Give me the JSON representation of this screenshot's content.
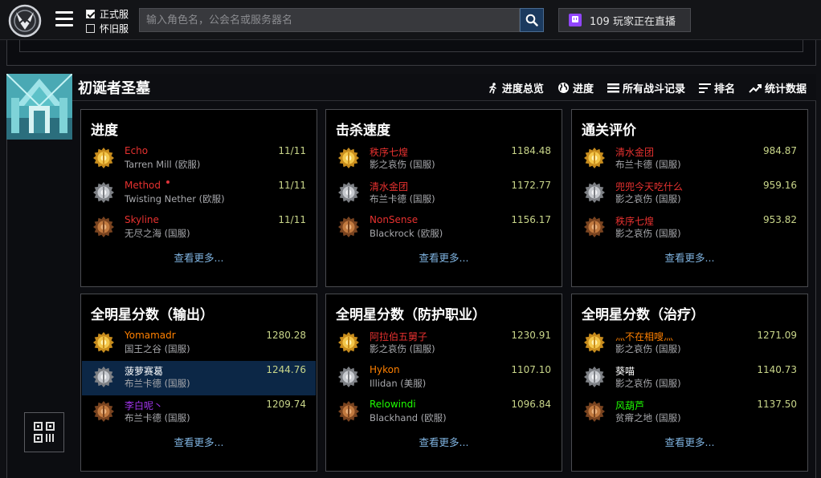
{
  "topbar": {
    "servers": [
      {
        "label": "正式服",
        "checked": true
      },
      {
        "label": "怀旧服",
        "checked": false
      }
    ],
    "search_placeholder": "输入角色名，公会名或服务器名",
    "twitch_text": "109 玩家正在直播"
  },
  "zone": {
    "title": "初诞者圣墓",
    "nav": [
      {
        "label": "进度总览",
        "icon": "runner-icon"
      },
      {
        "label": "进度",
        "icon": "globe-icon"
      },
      {
        "label": "所有战斗记录",
        "icon": "list-icon"
      },
      {
        "label": "排名",
        "icon": "ranking-icon"
      },
      {
        "label": "统计数据",
        "icon": "trend-icon"
      }
    ]
  },
  "colors": {
    "red": "#e6312f",
    "orange": "#ff8000",
    "green": "#1eff00",
    "purple": "#a335ee",
    "white": "#ffffff",
    "value": "#c9d68a",
    "link": "#7fb3e0"
  },
  "panels": [
    {
      "title": "进度",
      "more": "查看更多...",
      "entries": [
        {
          "medal": "gold",
          "name": "Echo",
          "sub": "Tarren Mill (欧服)",
          "value": "11/11",
          "color": "red"
        },
        {
          "medal": "silver",
          "name": "Method",
          "sub": "Twisting Nether (欧服)",
          "value": "11/11",
          "color": "red",
          "dot": true
        },
        {
          "medal": "bronze",
          "name": "Skyline",
          "sub": "无尽之海 (国服)",
          "value": "11/11",
          "color": "red"
        }
      ]
    },
    {
      "title": "击杀速度",
      "more": "查看更多...",
      "entries": [
        {
          "medal": "gold",
          "name": "秩序七煌",
          "sub": "影之哀伤 (国服)",
          "value": "1184.48",
          "color": "red"
        },
        {
          "medal": "silver",
          "name": "清水金团",
          "sub": "布兰卡德 (国服)",
          "value": "1172.77",
          "color": "red"
        },
        {
          "medal": "bronze",
          "name": "NonSense",
          "sub": "Blackrock (欧服)",
          "value": "1156.17",
          "color": "red"
        }
      ]
    },
    {
      "title": "通关评价",
      "more": "查看更多...",
      "entries": [
        {
          "medal": "gold",
          "name": "清水金团",
          "sub": "布兰卡德 (国服)",
          "value": "984.87",
          "color": "red"
        },
        {
          "medal": "silver",
          "name": "兜兜今天吃什么",
          "sub": "影之哀伤 (国服)",
          "value": "959.16",
          "color": "red"
        },
        {
          "medal": "bronze",
          "name": "秩序七煌",
          "sub": "影之哀伤 (国服)",
          "value": "953.82",
          "color": "red"
        }
      ]
    },
    {
      "title": "全明星分数（输出）",
      "more": "查看更多...",
      "entries": [
        {
          "medal": "gold",
          "name": "Yomamadr",
          "sub": "国王之谷 (国服)",
          "value": "1280.28",
          "color": "orange"
        },
        {
          "medal": "silver",
          "name": "菠萝赛葛",
          "sub": "布兰卡德 (国服)",
          "value": "1244.76",
          "color": "white",
          "highlight": true
        },
        {
          "medal": "bronze",
          "name": "李白呢丶",
          "sub": "布兰卡德 (国服)",
          "value": "1209.74",
          "color": "purple"
        }
      ]
    },
    {
      "title": "全明星分数（防护职业）",
      "more": "查看更多...",
      "entries": [
        {
          "medal": "gold",
          "name": "阿拉伯五舅子",
          "sub": "影之哀伤 (国服)",
          "value": "1230.91",
          "color": "red"
        },
        {
          "medal": "silver",
          "name": "Hykon",
          "sub": "Illidan (美服)",
          "value": "1107.10",
          "color": "orange"
        },
        {
          "medal": "bronze",
          "name": "Relowindi",
          "sub": "Blackhand (欧服)",
          "value": "1096.84",
          "color": "green"
        }
      ]
    },
    {
      "title": "全明星分数（治疗）",
      "more": "查看更多...",
      "entries": [
        {
          "medal": "gold",
          "name": "灬不在相嗖灬",
          "sub": "影之哀伤 (国服)",
          "value": "1271.09",
          "color": "orange"
        },
        {
          "medal": "silver",
          "name": "葵喵",
          "sub": "影之哀伤 (国服)",
          "value": "1140.73",
          "color": "white"
        },
        {
          "medal": "bronze",
          "name": "风葫芦",
          "sub": "贫瘠之地 (国服)",
          "value": "1137.50",
          "color": "green"
        }
      ]
    }
  ]
}
